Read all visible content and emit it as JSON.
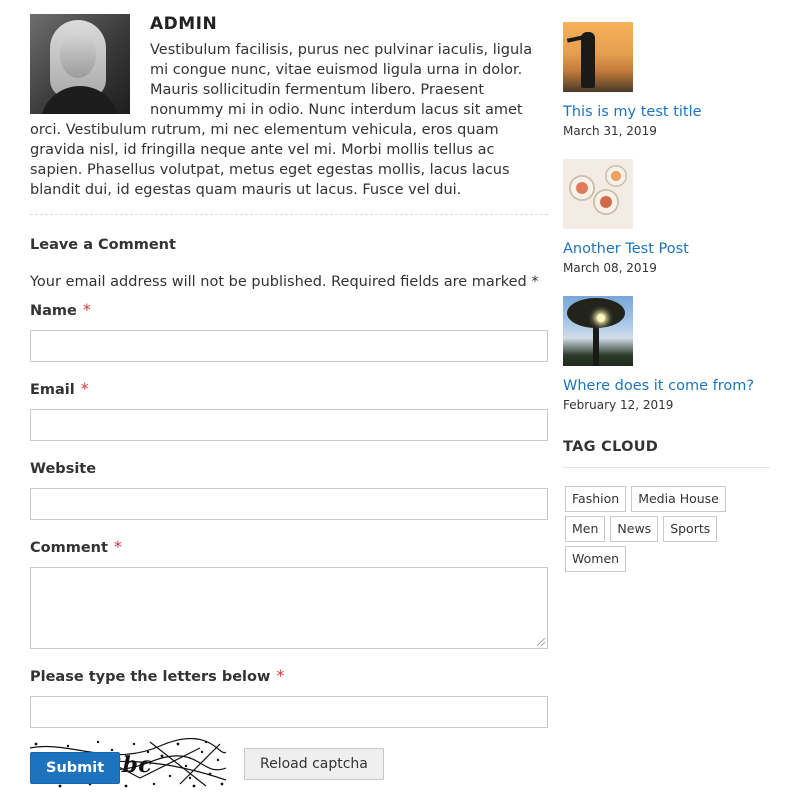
{
  "author": {
    "name": "ADMIN",
    "bio": "Vestibulum facilisis, purus nec pulvinar iaculis, ligula mi congue nunc, vitae euismod ligula urna in dolor. Mauris sollicitudin fermentum libero. Praesent nonummy mi in odio. Nunc interdum lacus sit amet orci. Vestibulum rutrum, mi nec elementum vehicula, eros quam gravida nisl, id fringilla neque ante vel mi. Morbi mollis tellus ac sapien. Phasellus volutpat, metus eget egestas mollis, lacus lacus blandit dui, id egestas quam mauris ut lacus. Fusce vel dui."
  },
  "comment_form": {
    "title": "Leave a Comment",
    "notice": "Your email address will not be published. Required fields are marked *",
    "required_mark": "*",
    "fields": {
      "name": {
        "label": "Name",
        "value": ""
      },
      "email": {
        "label": "Email",
        "value": ""
      },
      "website": {
        "label": "Website",
        "value": ""
      },
      "comment": {
        "label": "Comment",
        "value": ""
      },
      "captcha": {
        "label": "Please type the letters below",
        "value": ""
      }
    },
    "captcha_text": "w3bc",
    "reload_label": "Reload captcha",
    "submit_label": "Submit"
  },
  "sidebar": {
    "recent_posts": [
      {
        "title": "This is my test title",
        "date": "March 31, 2019"
      },
      {
        "title": "Another Test Post",
        "date": "March 08, 2019"
      },
      {
        "title": "Where does it come from?",
        "date": "February 12, 2019"
      }
    ],
    "tag_cloud": {
      "heading": "TAG CLOUD",
      "tags": [
        "Fashion",
        "Media House",
        "Men",
        "News",
        "Sports",
        "Women"
      ]
    }
  },
  "colors": {
    "link": "#1e73be",
    "submit_bg": "#1e73be",
    "required": "#dd3333"
  }
}
